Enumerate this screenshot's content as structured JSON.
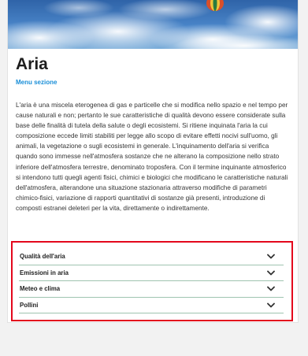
{
  "page": {
    "title": "Aria",
    "section_menu_label": "Menu sezione",
    "body": "L'aria è una miscela eterogenea di gas e particelle che si modifica nello spazio e nel tempo per cause naturali e non; pertanto le sue caratteristiche di qualità devono essere considerate sulla base delle finalità di tutela della salute o degli ecosistemi. Si ritiene inquinata l'aria la cui composizione eccede limiti stabiliti per legge allo scopo di evitare effetti nocivi sull'uomo, gli animali, la vegetazione o sugli ecosistemi in generale. L'inquinamento dell'aria si verifica quando sono immesse nell'atmosfera sostanze che ne alterano la composizione nello strato inferiore dell'atmosfera terrestre, denominato troposfera. Con il termine inquinante atmosferico si intendono tutti quegli agenti fisici, chimici e biologici che modificano le caratteristiche naturali dell'atmosfera, alterandone una situazione stazionaria attraverso modifiche di parametri chimico-fisici, variazione di rapporti quantitativi di sostanze già presenti, introduzione di composti estranei deleteri per la vita, direttamente o indirettamente."
  },
  "accordion": {
    "items": [
      {
        "label": "Qualità dell'aria",
        "icon": "chevron-down-icon"
      },
      {
        "label": "Emissioni in aria",
        "icon": "chevron-down-icon"
      },
      {
        "label": "Meteo e clima",
        "icon": "chevron-down-icon"
      },
      {
        "label": "Pollini",
        "icon": "chevron-down-icon"
      }
    ]
  },
  "colors": {
    "highlight_border": "#e3071c",
    "link": "#1a8fd8",
    "divider": "#9fc4b0"
  }
}
